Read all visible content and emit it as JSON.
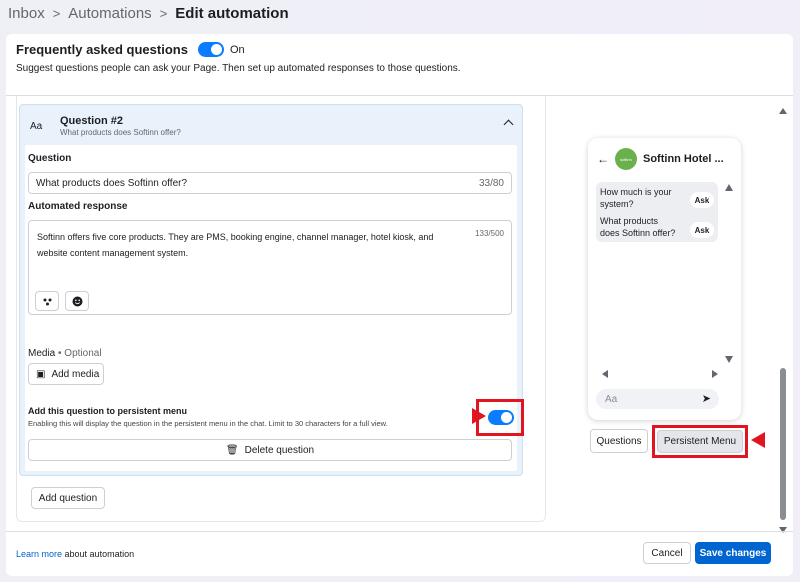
{
  "breadcrumb": {
    "items": [
      "Inbox",
      "Automations"
    ],
    "current": "Edit automation"
  },
  "faq": {
    "title": "Frequently asked questions",
    "toggle_state": "On",
    "description": "Suggest questions people can ask your Page. Then set up automated responses to those questions."
  },
  "question_card": {
    "type_icon": "Aa",
    "number": "Question #2",
    "subtitle": "What products does Softinn offer?",
    "question_label": "Question",
    "question_value": "What products does Softinn offer?",
    "question_count": "33/80",
    "response_label": "Automated response",
    "response_text": "Softinn offers five core products. They are PMS, booking engine, channel manager, hotel kiosk, and website content management system.",
    "response_count": "133/500",
    "media_label": "Media",
    "media_optional": " • Optional",
    "add_media": "Add media",
    "persistent_title": "Add this question to persistent menu",
    "persistent_desc": "Enabling this will display the question in the persistent menu in the chat. Limit to 30 characters for a full view.",
    "delete_label": "Delete question"
  },
  "add_question": "Add question",
  "preview": {
    "page_name": "Softinn Hotel ...",
    "avatar_text": "softinn",
    "questions": [
      "How much is your system?",
      "What products does Softinn offer?"
    ],
    "ask_label": "Ask",
    "input_placeholder": "Aa",
    "tab_questions": "Questions",
    "tab_persistent": "Persistent Menu"
  },
  "footer": {
    "learn_link": "Learn more",
    "learn_rest": " about automation",
    "cancel": "Cancel",
    "save": "Save changes"
  },
  "colors": {
    "accent": "#0064d1",
    "toggle": "#0a7cff",
    "highlight": "#e0151f"
  }
}
